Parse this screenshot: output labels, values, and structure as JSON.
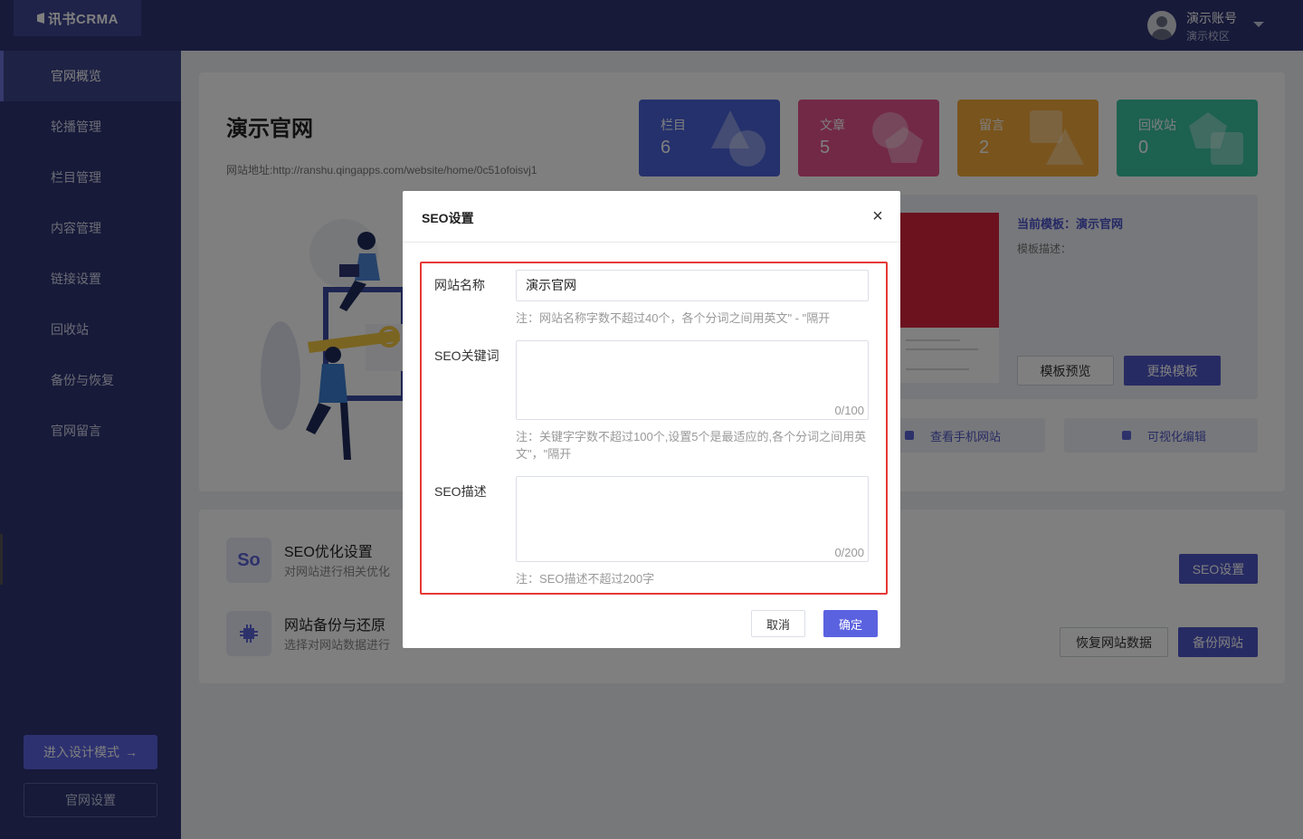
{
  "app": {
    "logo_text": "讯书CRMA",
    "user_name": "演示账号",
    "user_campus": "演示校区"
  },
  "sidebar": {
    "items": [
      {
        "label": "官网概览",
        "active": true
      },
      {
        "label": "轮播管理"
      },
      {
        "label": "栏目管理"
      },
      {
        "label": "内容管理"
      },
      {
        "label": "链接设置"
      },
      {
        "label": "回收站"
      },
      {
        "label": "备份与恢复"
      },
      {
        "label": "官网留言"
      }
    ],
    "design_mode_label": "进入设计模式",
    "design_mode_arrow": "→",
    "site_settings_label": "官网设置"
  },
  "overview": {
    "site_title": "演示官网",
    "site_url": "网站地址:http://ranshu.qingapps.com/website/home/0c51ofoisvj1",
    "stats": [
      {
        "label": "栏目",
        "value": "6",
        "color": "#4a63d9"
      },
      {
        "label": "文章",
        "value": "5",
        "color": "#e4528c"
      },
      {
        "label": "留言",
        "value": "2",
        "color": "#f2a83a"
      },
      {
        "label": "回收站",
        "value": "0",
        "color": "#3bc2a2"
      }
    ],
    "template": {
      "current_label": "当前模板：演示官网",
      "description_label": "模板描述：",
      "preview_label": "模板预览",
      "change_label": "更换模板"
    },
    "links": {
      "mobile_label": "查看手机网站",
      "visual_edit_label": "可视化编辑"
    }
  },
  "features": {
    "seo": {
      "icon_text": "So",
      "title": "SEO优化设置",
      "desc": "对网站进行相关优化",
      "button": "SEO设置"
    },
    "backup": {
      "title": "网站备份与还原",
      "desc": "选择对网站数据进行",
      "restore_button": "恢复网站数据",
      "backup_button": "备份网站"
    }
  },
  "modal": {
    "title": "SEO设置",
    "close": "×",
    "site_name_label": "网站名称",
    "site_name_value": "演示官网",
    "site_name_hint": "注：网站名称字数不超过40个，各个分词之间用英文\" - \"隔开",
    "keywords_label": "SEO关键词",
    "keywords_value": "",
    "keywords_counter": "0/100",
    "keywords_hint": "注：关键字字数不超过100个,设置5个是最适应的,各个分词之间用英文\"，\"隔开",
    "description_label": "SEO描述",
    "description_value": "",
    "description_counter": "0/200",
    "description_hint": "注：SEO描述不超过200字",
    "cancel_label": "取消",
    "ok_label": "确定"
  }
}
